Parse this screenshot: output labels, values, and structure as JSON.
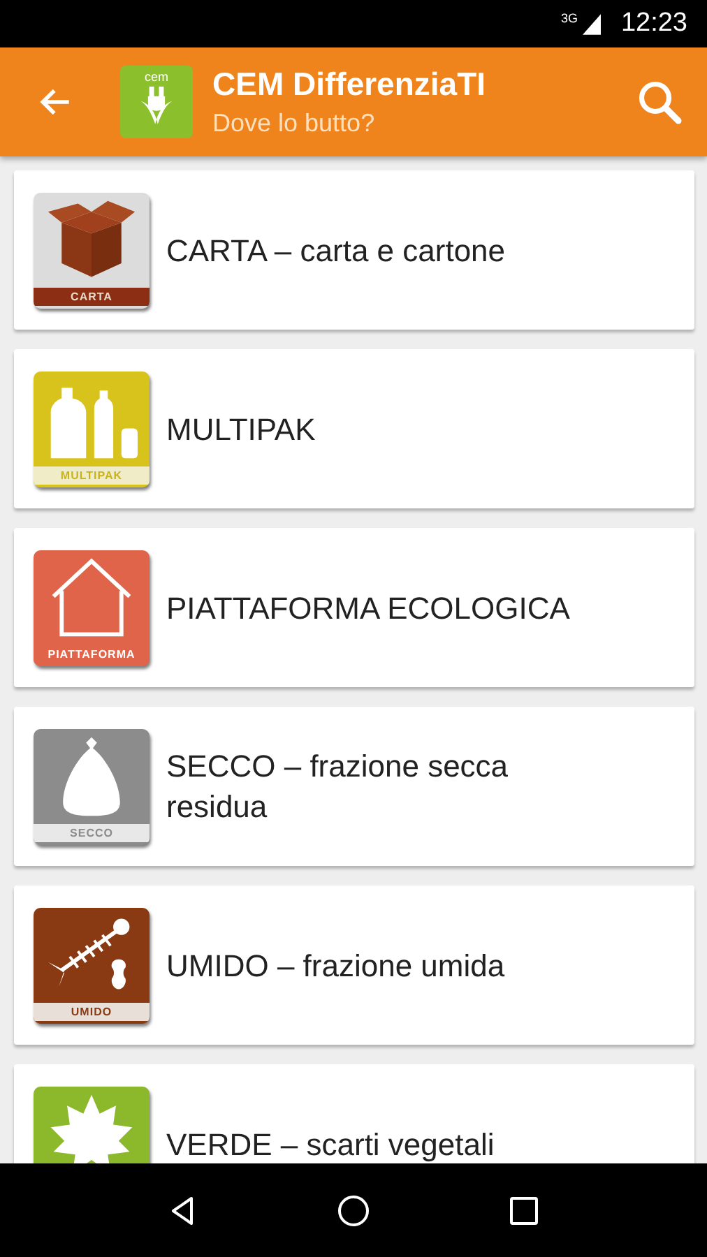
{
  "status_bar": {
    "network": "3G",
    "time": "12:23"
  },
  "app_bar": {
    "title": "CEM DifferenziaTI",
    "subtitle": "Dove lo butto?",
    "logo_text": "cem"
  },
  "categories": [
    {
      "kind": "carta",
      "tile_label": "CARTA",
      "label": "CARTA – carta e cartone"
    },
    {
      "kind": "multipak",
      "tile_label": "MULTIPAK",
      "label": "MULTIPAK"
    },
    {
      "kind": "piattaforma",
      "tile_label": "PIATTAFORMA",
      "label": "PIATTAFORMA ECOLOGICA"
    },
    {
      "kind": "secco",
      "tile_label": "SECCO",
      "label": "SECCO – frazione secca residua"
    },
    {
      "kind": "umido",
      "tile_label": "UMIDO",
      "label": "UMIDO – frazione umida"
    },
    {
      "kind": "verde",
      "label": "VERDE – scarti vegetali"
    }
  ]
}
